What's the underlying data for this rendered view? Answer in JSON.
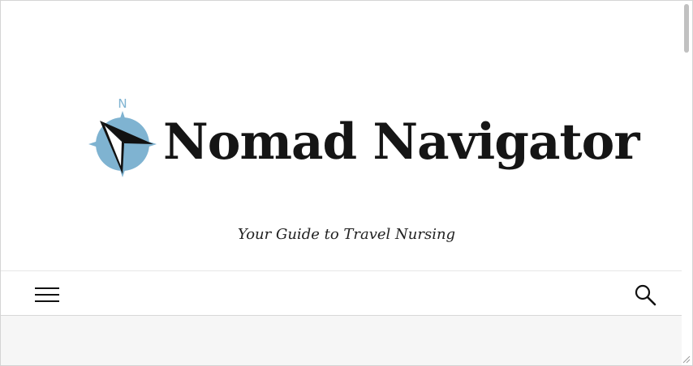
{
  "site": {
    "title": "Nomad Navigator",
    "tagline": "Your Guide to Travel Nursing",
    "logo": {
      "compass_letter": "N",
      "icon": "compass-logo-icon",
      "colors": {
        "disc": "#7fb3d1",
        "needle_dark": "#111111",
        "needle_light": "#ffffff"
      }
    }
  },
  "navbar": {
    "menu_icon": "hamburger-menu-icon",
    "search_icon": "search-icon"
  },
  "colors": {
    "title_text": "#151515",
    "content_background": "#f6f6f6",
    "border": "#d8d8d8"
  }
}
